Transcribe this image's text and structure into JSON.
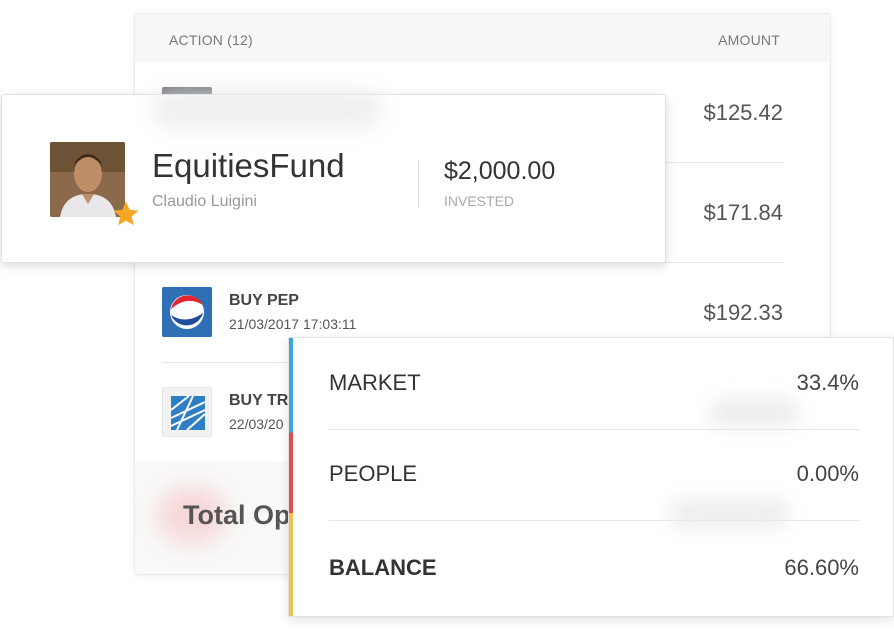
{
  "table": {
    "header": {
      "action": "ACTION (12)",
      "amount": "AMOUNT"
    },
    "rows": [
      {
        "title": "",
        "date": "",
        "amount": "$125.42",
        "logo": "dark-square-icon"
      },
      {
        "title": "",
        "date": "",
        "amount": "$171.84",
        "logo": "blank-icon"
      },
      {
        "title": "BUY PEP",
        "date": "21/03/2017 17:03:11",
        "amount": "$192.33",
        "logo": "pepsi-logo-icon"
      },
      {
        "title": "BUY TR",
        "date": "22/03/20",
        "amount": "",
        "logo": "tr-logo-icon"
      }
    ],
    "total_label": "Total Op"
  },
  "fund": {
    "name": "EquitiesFund",
    "owner": "Claudio Luigini",
    "invested_amount": "$2,000.00",
    "invested_label": "INVESTED"
  },
  "allocation": {
    "rows": [
      {
        "label": "MARKET",
        "value": "33.4%"
      },
      {
        "label": "PEOPLE",
        "value": "0.00%"
      },
      {
        "label": "BALANCE",
        "value": "66.60%"
      }
    ],
    "colors": {
      "market": "#3aa6e0",
      "people": "#e64a4a",
      "balance": "#f1c24b"
    }
  },
  "colors": {
    "star": "#f5a623",
    "pepsi_blue": "#2f6fb6"
  }
}
